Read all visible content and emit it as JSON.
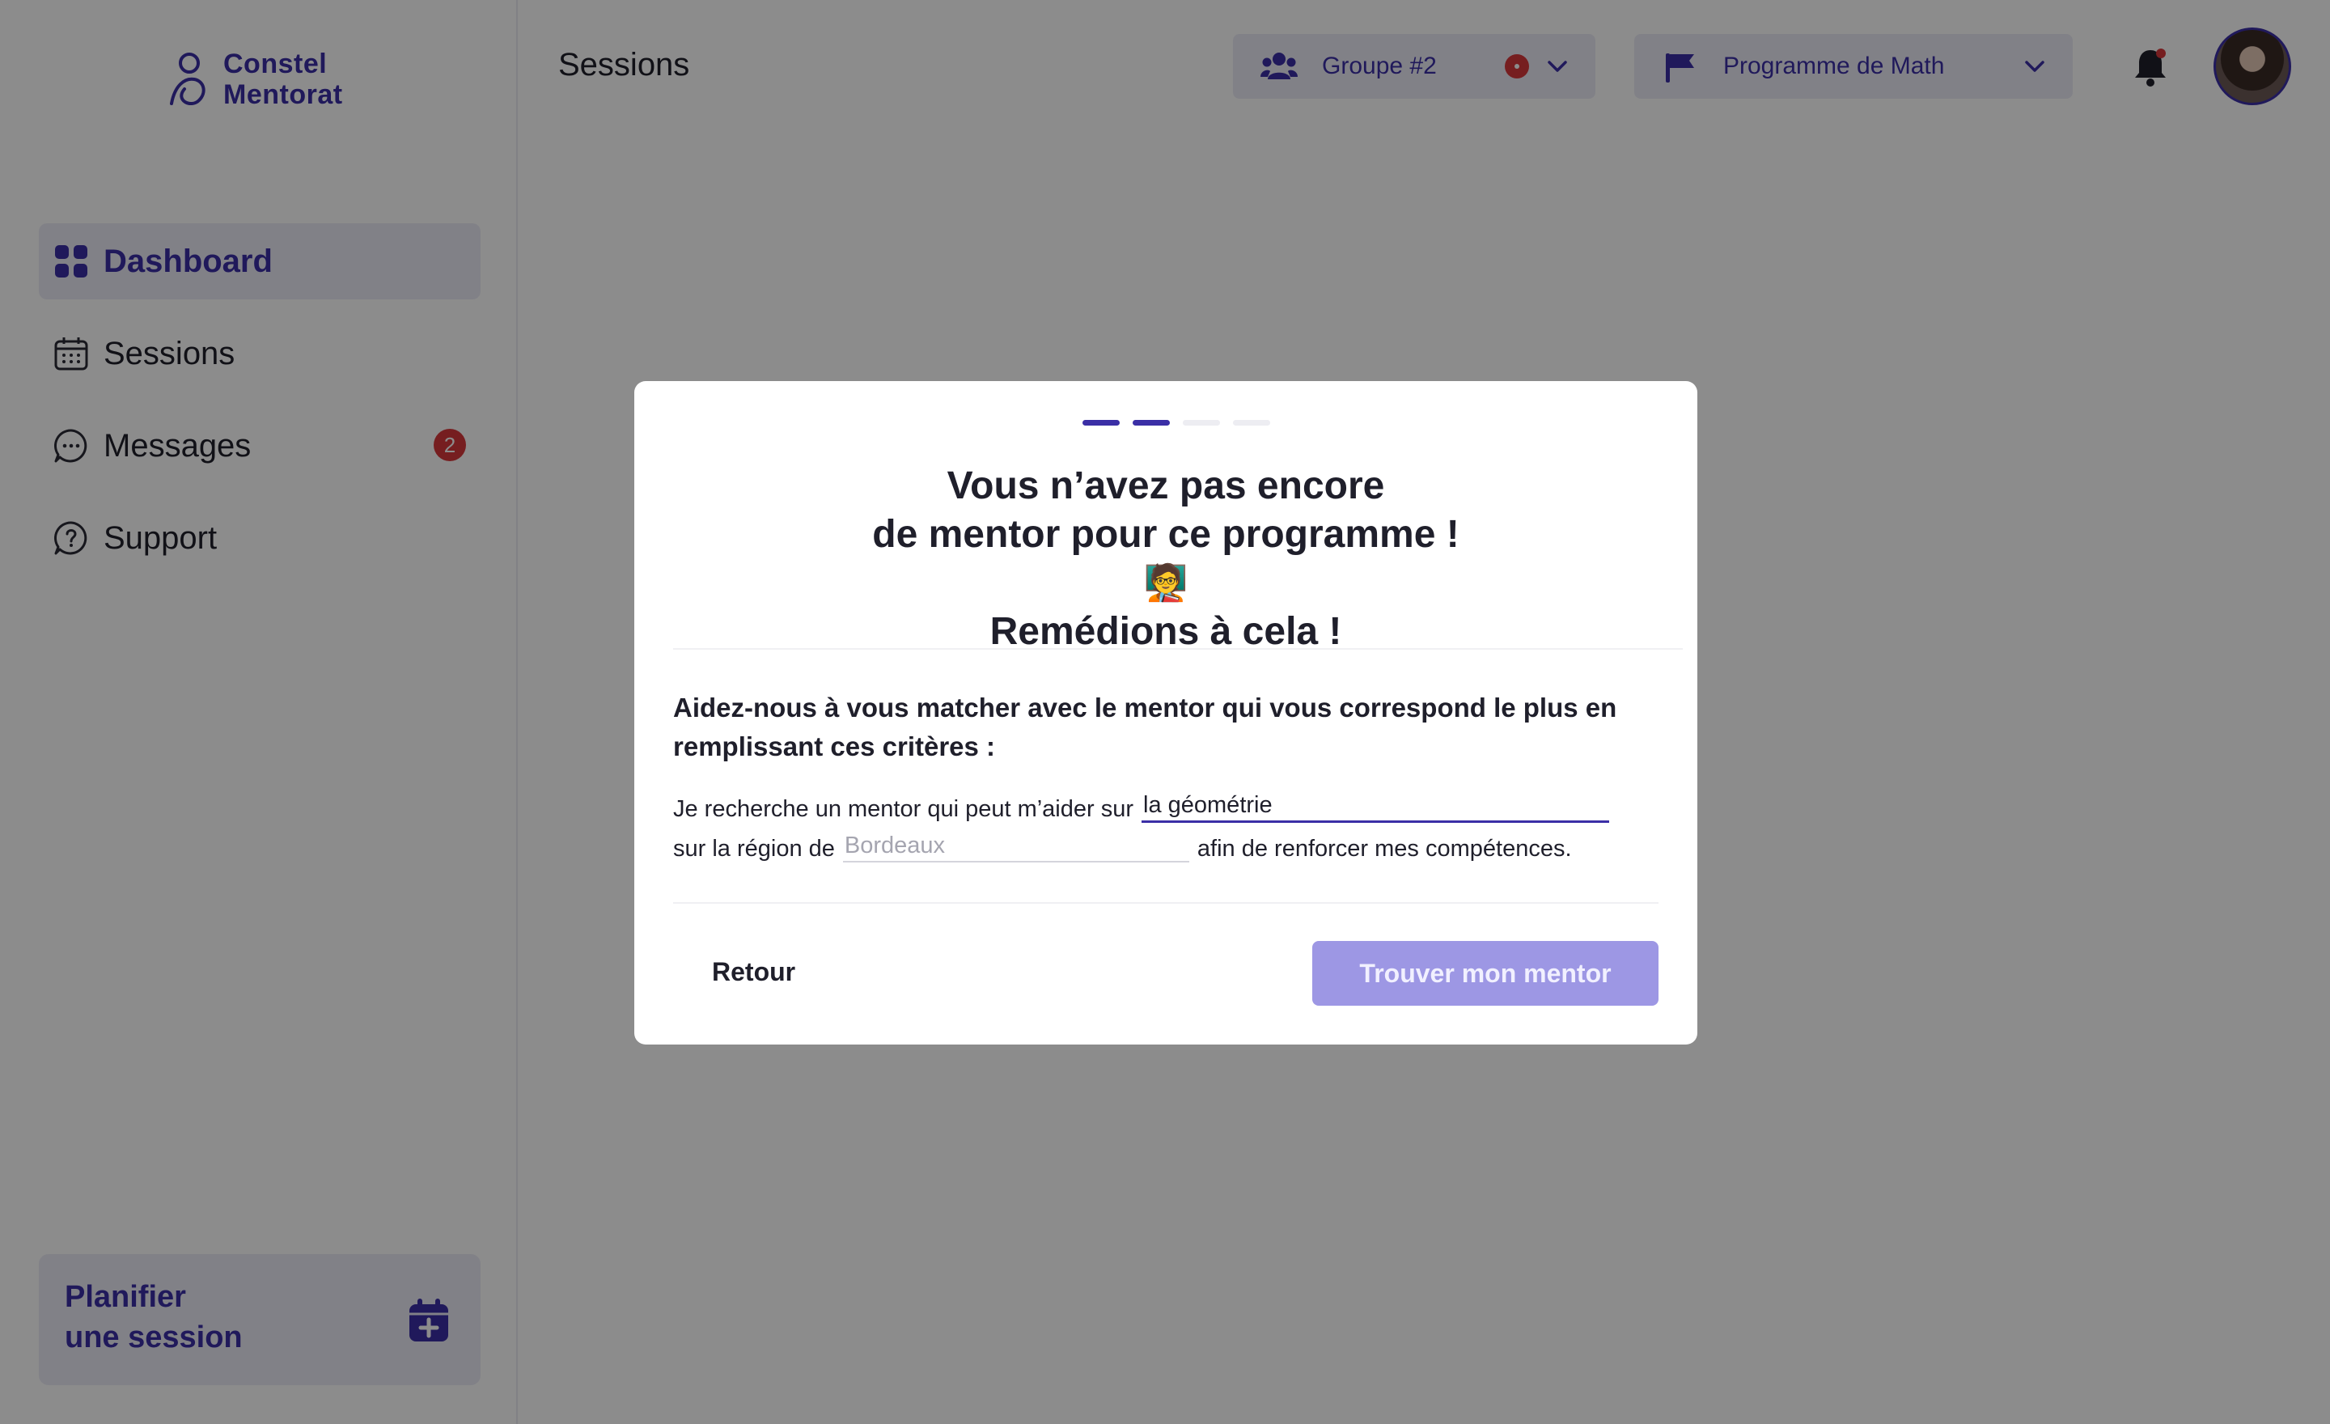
{
  "brand": {
    "line1": "Constel",
    "line2": "Mentorat"
  },
  "sidebar": {
    "items": [
      {
        "label": "Dashboard",
        "icon": "grid-icon"
      },
      {
        "label": "Sessions",
        "icon": "calendar-icon"
      },
      {
        "label": "Messages",
        "icon": "chat-icon",
        "badge": "2"
      },
      {
        "label": "Support",
        "icon": "help-icon"
      }
    ],
    "cta": {
      "line1": "Planifier",
      "line2": "une session",
      "icon": "calendar-plus-icon"
    }
  },
  "header": {
    "title": "Sessions",
    "group": {
      "label": "Groupe #2",
      "icon": "users-icon"
    },
    "program": {
      "label": "Programme de Math",
      "icon": "flag-icon"
    }
  },
  "modal": {
    "steps": {
      "total": 4,
      "current": 2
    },
    "title": {
      "line1": "Vous n’avez pas encore",
      "line2": "de mentor pour ce programme !",
      "emoji": "🧑‍🏫",
      "line3": "Remédions à cela !"
    },
    "intro": "Aidez-nous à vous matcher  avec le mentor qui vous correspond le plus en remplissant ces critères  :",
    "sentence1_prefix": "Je recherche un mentor qui peut m’aider sur",
    "topic_value": "la géométrie",
    "sentence2_prefix": "sur la région de",
    "region_placeholder": "Bordeaux",
    "sentence2_suffix": "afin de renforcer mes compétences.",
    "back_label": "Retour",
    "submit_label": "Trouver mon mentor"
  },
  "colors": {
    "accent": "#3b2fa6",
    "badge": "#d8373b",
    "button_disabled": "#9d97e4"
  }
}
